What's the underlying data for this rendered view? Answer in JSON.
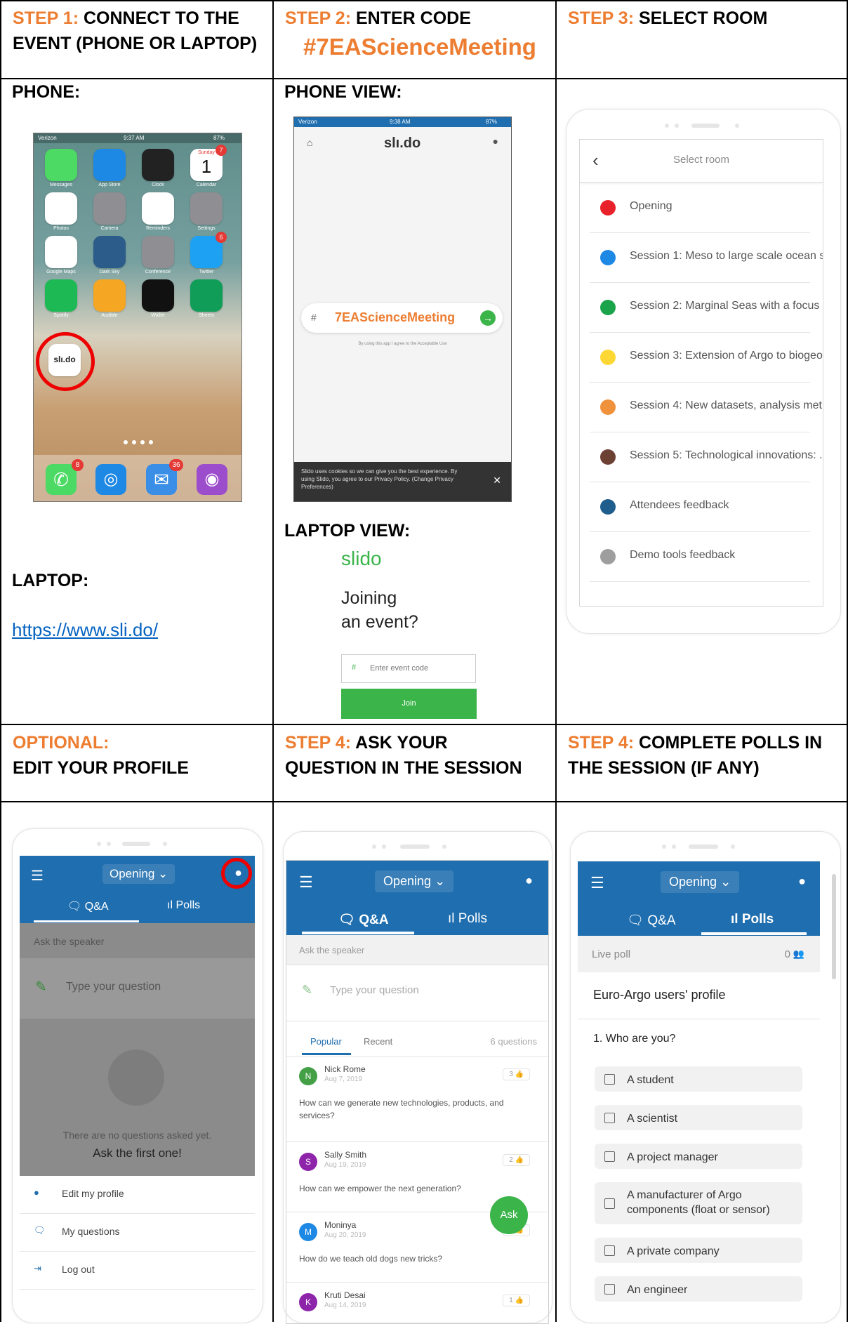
{
  "row1": {
    "c1": {
      "step": "STEP 1:",
      "text": "CONNECT TO THE EVENT (PHONE OR LAPTOP)"
    },
    "c2": {
      "step": "STEP 2:",
      "text": "ENTER CODE",
      "code": "#7EAScienceMeeting"
    },
    "c3": {
      "step": "STEP 3:",
      "text": "SELECT ROOM"
    }
  },
  "row2": {
    "phone_label": "PHONE:",
    "laptop_label": "LAPTOP:",
    "laptop_url": "https://www.sli.do/",
    "phone_view_label": "PHONE VIEW:",
    "laptop_view_label": "LAPTOP VIEW:"
  },
  "homescreen": {
    "carrier": "Verizon",
    "time": "9:37 AM",
    "battery": "87%",
    "apps": [
      "Messages",
      "App Store",
      "Clock",
      "Calendar",
      "Photos",
      "Camera",
      "Reminders",
      "Settings",
      "Google Maps",
      "Dark Sky",
      "Conference",
      "Twitter",
      "Spotify",
      "Audible",
      "Wallet",
      "Sheets",
      "sli.do"
    ],
    "calendar_day": "Sunday",
    "calendar_date": "1",
    "badges": {
      "calendar": "7",
      "twitter": "6",
      "phone": "8",
      "mail": "36"
    },
    "slido_label": "slı.do"
  },
  "phone_view": {
    "time": "9:38 AM",
    "carrier": "Verizon",
    "battery": "87%",
    "logo": "slı.do",
    "hash": "#",
    "code": "7EAScienceMeeting",
    "terms": "By using this app I agree to the Acceptable Use",
    "cookie": "Slido uses cookies so we can give you the best experience. By using Slido, you agree to our Privacy Policy. (Change Privacy Preferences)"
  },
  "laptop_view": {
    "logo": "slido",
    "line1": "Joining",
    "line2": "an event?",
    "hash": "#",
    "placeholder": "Enter event code",
    "join": "Join"
  },
  "select_room": {
    "title": "Select room",
    "back": "‹",
    "rooms": [
      {
        "name": "Opening",
        "color": "#e8212a"
      },
      {
        "name": "Session 1: Meso to large scale ocean s...",
        "color": "#1e88e5"
      },
      {
        "name": "Session 2: Marginal Seas with a focus ...",
        "color": "#1aa34a"
      },
      {
        "name": "Session 3: Extension of Argo to biogeo...",
        "color": "#fdd835"
      },
      {
        "name": "Session 4: New datasets, analysis met...",
        "color": "#f0913b"
      },
      {
        "name": "Session 5: Technological innovations: ...",
        "color": "#6d4034"
      },
      {
        "name": "Attendees feedback",
        "color": "#1f5d8d"
      },
      {
        "name": "Demo tools feedback",
        "color": "#9e9e9e"
      }
    ]
  },
  "row3": {
    "c1": {
      "step": "OPTIONAL:",
      "text": "EDIT YOUR PROFILE"
    },
    "c2": {
      "step": "STEP 4:",
      "text": "ASK YOUR QUESTION IN THE SESSION"
    },
    "c3": {
      "step": "STEP 4:",
      "text": "COMPLETE POLLS IN THE SESSION (IF ANY)"
    }
  },
  "profile": {
    "room": "Opening",
    "tab_qa": "Q&A",
    "tab_polls": "Polls",
    "ask": "Ask the speaker",
    "placeholder": "Type your question",
    "empty1": "There are no questions asked yet.",
    "empty2": "Ask the first one!",
    "menu": [
      "Edit my profile",
      "My questions",
      "Log out"
    ]
  },
  "qa": {
    "room": "Opening",
    "tab_qa": "Q&A",
    "tab_polls": "Polls",
    "ask": "Ask the speaker",
    "placeholder": "Type your question",
    "sort_popular": "Popular",
    "sort_recent": "Recent",
    "count": "6 questions",
    "questions": [
      {
        "initial": "N",
        "name": "Nick Rome",
        "date": "Aug 7, 2019",
        "likes": "3",
        "text": "How can we generate new technologies, products, and services?",
        "color": "#43a047"
      },
      {
        "initial": "S",
        "name": "Sally Smith",
        "date": "Aug 19, 2019",
        "likes": "2",
        "text": "How can we empower the next generation?",
        "color": "#8e24aa"
      },
      {
        "initial": "M",
        "name": "Moninya",
        "date": "Aug 20, 2019",
        "likes": "1",
        "text": "How do we teach old dogs new tricks?",
        "color": "#1e88e5"
      },
      {
        "initial": "K",
        "name": "Kruti Desai",
        "date": "Aug 14, 2019",
        "likes": "1",
        "text": "",
        "color": "#8e24aa"
      }
    ],
    "ask_button": "Ask"
  },
  "polls": {
    "room": "Opening",
    "tab_qa": "Q&A",
    "tab_polls": "Polls",
    "live": "Live poll",
    "participants": "0",
    "title": "Euro-Argo users' profile",
    "question": "1. Who are you?",
    "options": [
      "A student",
      "A scientist",
      "A project manager",
      "A manufacturer of Argo components (float or sensor)",
      "A private company",
      "An engineer"
    ]
  }
}
